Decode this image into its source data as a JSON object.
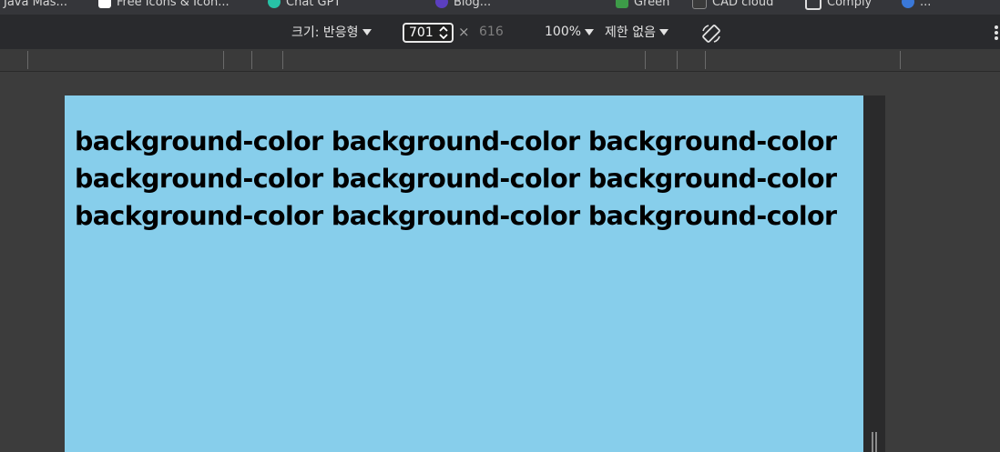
{
  "bookmarks": [
    {
      "label": "Java Mas...",
      "color": "#d04b4b"
    },
    {
      "label": "Free Icons & Icon...",
      "color": "#ffffff"
    },
    {
      "label": "Chat GPT",
      "color": "#27c2a6"
    },
    {
      "label": "Blog...",
      "color": "#5b3fbf"
    },
    {
      "label": "Green",
      "color": "#3d9b48"
    },
    {
      "label": "CAD cloud",
      "color": "#3a3a3a"
    },
    {
      "label": "Comply",
      "color": "#dddddd"
    },
    {
      "label": "...",
      "color": "#3a78d8"
    }
  ],
  "toolbar": {
    "size_label": "크기: 반응형",
    "width_value": "701",
    "times_symbol": "×",
    "height_value": "616",
    "zoom_label": "100%",
    "throttle_label": "제한 없음"
  },
  "page": {
    "text": "background-color background-color background-color background-color background-color background-color background-color background-color background-color",
    "background_color": "#87ceeb"
  }
}
